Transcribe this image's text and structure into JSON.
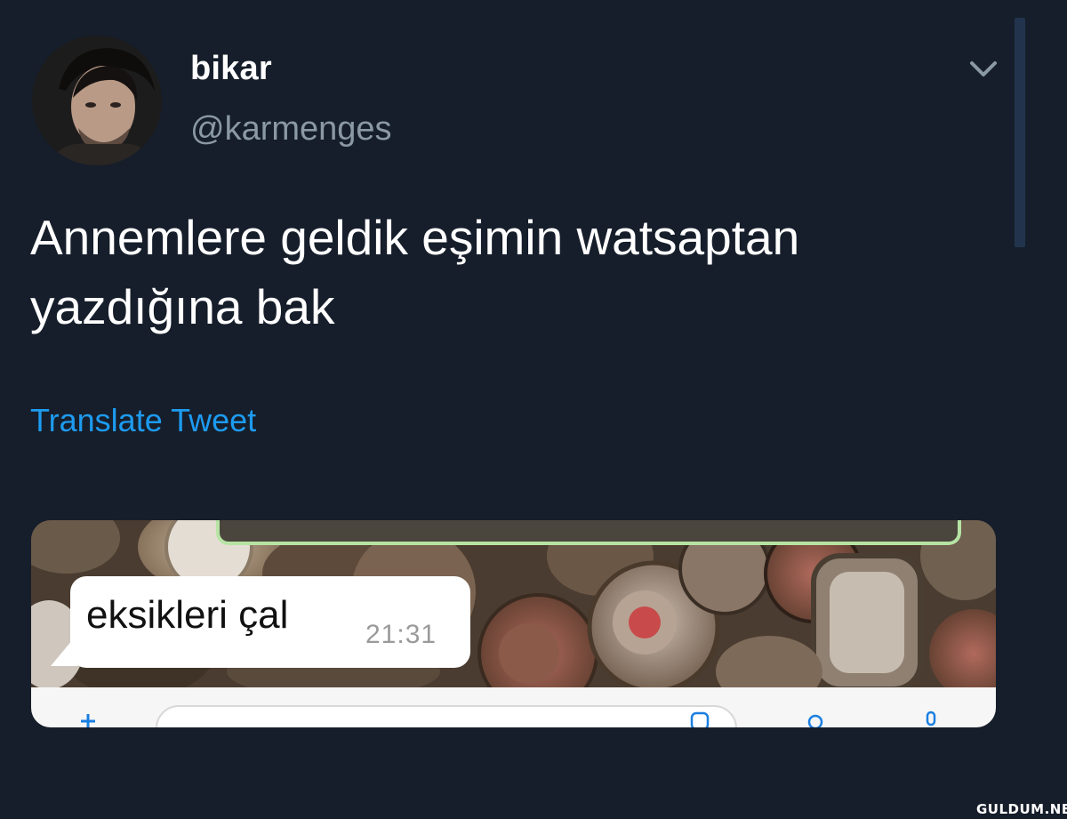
{
  "tweet": {
    "display_name": "bikar",
    "handle": "@karmenges",
    "text": "Annemlere geldik eşimin watsaptan yazdığına bak",
    "translate_label": "Translate Tweet",
    "avatar_icon": "profile-photo",
    "menu_icon": "chevron-down-icon"
  },
  "media": {
    "chat_message": "eksikleri çal",
    "chat_time": "21:31",
    "outgoing_bubble_color": "#b7e4a4",
    "incoming_bubble_color": "#ffffff"
  },
  "watermark": "GULDUM.NET",
  "colors": {
    "background": "#161e2b",
    "link": "#1d9bf0",
    "secondary_text": "#8b98a5"
  }
}
